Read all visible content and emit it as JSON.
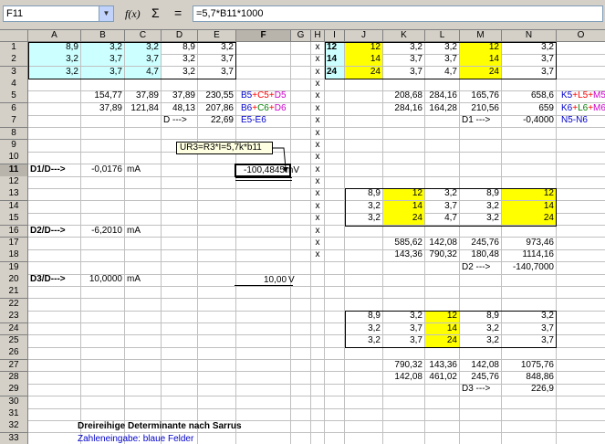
{
  "formula_bar": {
    "name_box": "F11",
    "function_wizard_icon": "f(x)",
    "sum_icon": "Σ",
    "equals_icon": "=",
    "formula": "=5,7*B11*1000"
  },
  "colors": {
    "blue_fill": "#ccffff",
    "yellow_fill": "#ffff00",
    "red": "#ff0000",
    "green": "#008000",
    "magenta": "#cc00cc",
    "blue": "#0000cc"
  },
  "columns": [
    "A",
    "B",
    "C",
    "D",
    "E",
    "F",
    "G",
    "H",
    "I",
    "J",
    "K",
    "L",
    "M",
    "N",
    "O"
  ],
  "rows": [
    "1",
    "2",
    "3",
    "4",
    "5",
    "6",
    "7",
    "8",
    "9",
    "10",
    "11",
    "12",
    "13",
    "14",
    "15",
    "16",
    "17",
    "18",
    "19",
    "20",
    "21",
    "22",
    "23",
    "24",
    "25",
    "26",
    "27",
    "28",
    "29",
    "30",
    "31",
    "32",
    "33"
  ],
  "selected_cell": {
    "col": "F",
    "row": "11"
  },
  "comment": "UR3=R3*I=5,7k*b11",
  "cells": [
    {
      "c": "A",
      "r": 1,
      "v": "8,9",
      "a": "r",
      "f": "blue"
    },
    {
      "c": "B",
      "r": 1,
      "v": "3,2",
      "a": "r",
      "f": "blue"
    },
    {
      "c": "C",
      "r": 1,
      "v": "3,2",
      "a": "r",
      "f": "blue"
    },
    {
      "c": "D",
      "r": 1,
      "v": "8,9",
      "a": "r"
    },
    {
      "c": "E",
      "r": 1,
      "v": "3,2",
      "a": "r"
    },
    {
      "c": "A",
      "r": 2,
      "v": "3,2",
      "a": "r",
      "f": "blue"
    },
    {
      "c": "B",
      "r": 2,
      "v": "3,7",
      "a": "r",
      "f": "blue"
    },
    {
      "c": "C",
      "r": 2,
      "v": "3,7",
      "a": "r",
      "f": "blue"
    },
    {
      "c": "D",
      "r": 2,
      "v": "3,2",
      "a": "r"
    },
    {
      "c": "E",
      "r": 2,
      "v": "3,7",
      "a": "r"
    },
    {
      "c": "A",
      "r": 3,
      "v": "3,2",
      "a": "r",
      "f": "blue"
    },
    {
      "c": "B",
      "r": 3,
      "v": "3,7",
      "a": "r",
      "f": "blue"
    },
    {
      "c": "C",
      "r": 3,
      "v": "4,7",
      "a": "r",
      "f": "blue"
    },
    {
      "c": "D",
      "r": 3,
      "v": "3,2",
      "a": "r"
    },
    {
      "c": "E",
      "r": 3,
      "v": "3,7",
      "a": "r"
    },
    {
      "c": "H",
      "r": 1,
      "v": "x",
      "a": "c"
    },
    {
      "c": "H",
      "r": 2,
      "v": "x",
      "a": "c"
    },
    {
      "c": "H",
      "r": 3,
      "v": "x",
      "a": "c"
    },
    {
      "c": "H",
      "r": 4,
      "v": "x",
      "a": "c"
    },
    {
      "c": "H",
      "r": 5,
      "v": "x",
      "a": "c"
    },
    {
      "c": "H",
      "r": 6,
      "v": "x",
      "a": "c"
    },
    {
      "c": "H",
      "r": 7,
      "v": "x",
      "a": "c"
    },
    {
      "c": "H",
      "r": 8,
      "v": "x",
      "a": "c"
    },
    {
      "c": "H",
      "r": 9,
      "v": "x",
      "a": "c"
    },
    {
      "c": "H",
      "r": 10,
      "v": "x",
      "a": "c"
    },
    {
      "c": "H",
      "r": 11,
      "v": "x",
      "a": "c"
    },
    {
      "c": "H",
      "r": 12,
      "v": "x",
      "a": "c"
    },
    {
      "c": "H",
      "r": 13,
      "v": "x",
      "a": "c"
    },
    {
      "c": "H",
      "r": 14,
      "v": "x",
      "a": "c"
    },
    {
      "c": "H",
      "r": 15,
      "v": "x",
      "a": "c"
    },
    {
      "c": "H",
      "r": 16,
      "v": "x",
      "a": "c"
    },
    {
      "c": "H",
      "r": 17,
      "v": "x",
      "a": "c"
    },
    {
      "c": "H",
      "r": 18,
      "v": "x",
      "a": "c"
    },
    {
      "c": "I",
      "r": 1,
      "v": "12",
      "a": "l",
      "f": "blue",
      "b": true
    },
    {
      "c": "J",
      "r": 1,
      "v": "12",
      "a": "r",
      "f": "yellow"
    },
    {
      "c": "K",
      "r": 1,
      "v": "3,2",
      "a": "r"
    },
    {
      "c": "L",
      "r": 1,
      "v": "3,2",
      "a": "r"
    },
    {
      "c": "M",
      "r": 1,
      "v": "12",
      "a": "r",
      "f": "yellow"
    },
    {
      "c": "N",
      "r": 1,
      "v": "3,2",
      "a": "r"
    },
    {
      "c": "I",
      "r": 2,
      "v": "14",
      "a": "l",
      "f": "blue",
      "b": true
    },
    {
      "c": "J",
      "r": 2,
      "v": "14",
      "a": "r",
      "f": "yellow"
    },
    {
      "c": "K",
      "r": 2,
      "v": "3,7",
      "a": "r"
    },
    {
      "c": "L",
      "r": 2,
      "v": "3,7",
      "a": "r"
    },
    {
      "c": "M",
      "r": 2,
      "v": "14",
      "a": "r",
      "f": "yellow"
    },
    {
      "c": "N",
      "r": 2,
      "v": "3,7",
      "a": "r"
    },
    {
      "c": "I",
      "r": 3,
      "v": "24",
      "a": "l",
      "f": "blue",
      "b": true
    },
    {
      "c": "J",
      "r": 3,
      "v": "24",
      "a": "r",
      "f": "yellow"
    },
    {
      "c": "K",
      "r": 3,
      "v": "3,7",
      "a": "r"
    },
    {
      "c": "L",
      "r": 3,
      "v": "4,7",
      "a": "r"
    },
    {
      "c": "M",
      "r": 3,
      "v": "24",
      "a": "r",
      "f": "yellow"
    },
    {
      "c": "N",
      "r": 3,
      "v": "3,7",
      "a": "r"
    },
    {
      "c": "B",
      "r": 5,
      "v": "154,77",
      "a": "r"
    },
    {
      "c": "C",
      "r": 5,
      "v": "37,89",
      "a": "r"
    },
    {
      "c": "D",
      "r": 5,
      "v": "37,89",
      "a": "r"
    },
    {
      "c": "E",
      "r": 5,
      "v": "230,55",
      "a": "r"
    },
    {
      "c": "B",
      "r": 6,
      "v": "37,89",
      "a": "r"
    },
    {
      "c": "C",
      "r": 6,
      "v": "121,84",
      "a": "r"
    },
    {
      "c": "D",
      "r": 6,
      "v": "48,13",
      "a": "r"
    },
    {
      "c": "E",
      "r": 6,
      "v": "207,86",
      "a": "r"
    },
    {
      "c": "D",
      "r": 7,
      "v": "D --->",
      "a": "l"
    },
    {
      "c": "E",
      "r": 7,
      "v": "22,69",
      "a": "r"
    },
    {
      "c": "K",
      "r": 5,
      "v": "208,68",
      "a": "r"
    },
    {
      "c": "L",
      "r": 5,
      "v": "284,16",
      "a": "r"
    },
    {
      "c": "M",
      "r": 5,
      "v": "165,76",
      "a": "r"
    },
    {
      "c": "N",
      "r": 5,
      "v": "658,6",
      "a": "r"
    },
    {
      "c": "K",
      "r": 6,
      "v": "284,16",
      "a": "r"
    },
    {
      "c": "L",
      "r": 6,
      "v": "164,28",
      "a": "r"
    },
    {
      "c": "M",
      "r": 6,
      "v": "210,56",
      "a": "r"
    },
    {
      "c": "N",
      "r": 6,
      "v": "659",
      "a": "r"
    },
    {
      "c": "M",
      "r": 7,
      "v": "D1 --->",
      "a": "l"
    },
    {
      "c": "N",
      "r": 7,
      "v": "-0,4000",
      "a": "r"
    },
    {
      "c": "A",
      "r": 11,
      "v": "D1/D--->",
      "a": "l",
      "b": true
    },
    {
      "c": "B",
      "r": 11,
      "v": "-0,0176",
      "a": "r"
    },
    {
      "c": "C",
      "r": 11,
      "v": "mA",
      "a": "l"
    },
    {
      "c": "A",
      "r": 16,
      "v": "D2/D--->",
      "a": "l",
      "b": true
    },
    {
      "c": "B",
      "r": 16,
      "v": "-6,2010",
      "a": "r"
    },
    {
      "c": "C",
      "r": 16,
      "v": "mA",
      "a": "l"
    },
    {
      "c": "A",
      "r": 20,
      "v": "D3/D--->",
      "a": "l",
      "b": true
    },
    {
      "c": "B",
      "r": 20,
      "v": "10,0000",
      "a": "r"
    },
    {
      "c": "C",
      "r": 20,
      "v": "mA",
      "a": "l"
    },
    {
      "c": "J",
      "r": 13,
      "v": "8,9",
      "a": "r"
    },
    {
      "c": "K",
      "r": 13,
      "v": "12",
      "a": "r",
      "f": "yellow"
    },
    {
      "c": "L",
      "r": 13,
      "v": "3,2",
      "a": "r"
    },
    {
      "c": "M",
      "r": 13,
      "v": "8,9",
      "a": "r"
    },
    {
      "c": "N",
      "r": 13,
      "v": "12",
      "a": "r",
      "f": "yellow"
    },
    {
      "c": "J",
      "r": 14,
      "v": "3,2",
      "a": "r"
    },
    {
      "c": "K",
      "r": 14,
      "v": "14",
      "a": "r",
      "f": "yellow"
    },
    {
      "c": "L",
      "r": 14,
      "v": "3,7",
      "a": "r"
    },
    {
      "c": "M",
      "r": 14,
      "v": "3,2",
      "a": "r"
    },
    {
      "c": "N",
      "r": 14,
      "v": "14",
      "a": "r",
      "f": "yellow"
    },
    {
      "c": "J",
      "r": 15,
      "v": "3,2",
      "a": "r"
    },
    {
      "c": "K",
      "r": 15,
      "v": "24",
      "a": "r",
      "f": "yellow"
    },
    {
      "c": "L",
      "r": 15,
      "v": "4,7",
      "a": "r"
    },
    {
      "c": "M",
      "r": 15,
      "v": "3,2",
      "a": "r"
    },
    {
      "c": "N",
      "r": 15,
      "v": "24",
      "a": "r",
      "f": "yellow"
    },
    {
      "c": "K",
      "r": 17,
      "v": "585,62",
      "a": "r"
    },
    {
      "c": "L",
      "r": 17,
      "v": "142,08",
      "a": "r"
    },
    {
      "c": "M",
      "r": 17,
      "v": "245,76",
      "a": "r"
    },
    {
      "c": "N",
      "r": 17,
      "v": "973,46",
      "a": "r"
    },
    {
      "c": "K",
      "r": 18,
      "v": "143,36",
      "a": "r"
    },
    {
      "c": "L",
      "r": 18,
      "v": "790,32",
      "a": "r"
    },
    {
      "c": "M",
      "r": 18,
      "v": "180,48",
      "a": "r"
    },
    {
      "c": "N",
      "r": 18,
      "v": "1114,16",
      "a": "r"
    },
    {
      "c": "M",
      "r": 19,
      "v": "D2 --->",
      "a": "l"
    },
    {
      "c": "N",
      "r": 19,
      "v": "-140,7000",
      "a": "r"
    },
    {
      "c": "J",
      "r": 23,
      "v": "8,9",
      "a": "r"
    },
    {
      "c": "K",
      "r": 23,
      "v": "3,2",
      "a": "r"
    },
    {
      "c": "L",
      "r": 23,
      "v": "12",
      "a": "r",
      "f": "yellow"
    },
    {
      "c": "M",
      "r": 23,
      "v": "8,9",
      "a": "r"
    },
    {
      "c": "N",
      "r": 23,
      "v": "3,2",
      "a": "r"
    },
    {
      "c": "J",
      "r": 24,
      "v": "3,2",
      "a": "r"
    },
    {
      "c": "K",
      "r": 24,
      "v": "3,7",
      "a": "r"
    },
    {
      "c": "L",
      "r": 24,
      "v": "14",
      "a": "r",
      "f": "yellow"
    },
    {
      "c": "M",
      "r": 24,
      "v": "3,2",
      "a": "r"
    },
    {
      "c": "N",
      "r": 24,
      "v": "3,7",
      "a": "r"
    },
    {
      "c": "J",
      "r": 25,
      "v": "3,2",
      "a": "r"
    },
    {
      "c": "K",
      "r": 25,
      "v": "3,7",
      "a": "r"
    },
    {
      "c": "L",
      "r": 25,
      "v": "24",
      "a": "r",
      "f": "yellow"
    },
    {
      "c": "M",
      "r": 25,
      "v": "3,2",
      "a": "r"
    },
    {
      "c": "N",
      "r": 25,
      "v": "3,7",
      "a": "r"
    },
    {
      "c": "K",
      "r": 27,
      "v": "790,32",
      "a": "r"
    },
    {
      "c": "L",
      "r": 27,
      "v": "143,36",
      "a": "r"
    },
    {
      "c": "M",
      "r": 27,
      "v": "142,08",
      "a": "r"
    },
    {
      "c": "N",
      "r": 27,
      "v": "1075,76",
      "a": "r"
    },
    {
      "c": "K",
      "r": 28,
      "v": "142,08",
      "a": "r"
    },
    {
      "c": "L",
      "r": 28,
      "v": "461,02",
      "a": "r"
    },
    {
      "c": "M",
      "r": 28,
      "v": "245,76",
      "a": "r"
    },
    {
      "c": "N",
      "r": 28,
      "v": "848,86",
      "a": "r"
    },
    {
      "c": "M",
      "r": 29,
      "v": "D3 --->",
      "a": "l"
    },
    {
      "c": "N",
      "r": 29,
      "v": "226,9",
      "a": "r"
    }
  ],
  "rich": [
    {
      "c": "F",
      "r": 5,
      "parts": [
        {
          "t": "B5",
          "col": "blue"
        },
        {
          "t": "+",
          "col": "red"
        },
        {
          "t": "C5",
          "col": "red"
        },
        {
          "t": "+",
          "col": "red"
        },
        {
          "t": "D5",
          "col": "magenta"
        }
      ]
    },
    {
      "c": "F",
      "r": 6,
      "parts": [
        {
          "t": "B6",
          "col": "blue"
        },
        {
          "t": "+",
          "col": "red"
        },
        {
          "t": "C6",
          "col": "green"
        },
        {
          "t": "+",
          "col": "red"
        },
        {
          "t": "D6",
          "col": "magenta"
        }
      ]
    },
    {
      "c": "F",
      "r": 7,
      "parts": [
        {
          "t": "E5-E6",
          "col": "blue"
        }
      ]
    },
    {
      "c": "O",
      "r": 5,
      "parts": [
        {
          "t": "K5",
          "col": "blue"
        },
        {
          "t": "+",
          "col": "red"
        },
        {
          "t": "L5",
          "col": "red"
        },
        {
          "t": "+",
          "col": "red"
        },
        {
          "t": "M5",
          "col": "magenta"
        }
      ]
    },
    {
      "c": "O",
      "r": 6,
      "parts": [
        {
          "t": "K6",
          "col": "blue"
        },
        {
          "t": "+",
          "col": "red"
        },
        {
          "t": "L6",
          "col": "green"
        },
        {
          "t": "+",
          "col": "red"
        },
        {
          "t": "M6",
          "col": "magenta"
        }
      ]
    },
    {
      "c": "O",
      "r": 7,
      "parts": [
        {
          "t": "N5-N6",
          "col": "blue"
        }
      ]
    }
  ],
  "f11_value": "-100,4845",
  "f11_unit": "mV",
  "f20_value": "10,00",
  "f20_unit": "V",
  "title_row32": "Dreireihige Determinante nach Sarrus",
  "note_row33": "Zahleneingabe: blaue Felder"
}
